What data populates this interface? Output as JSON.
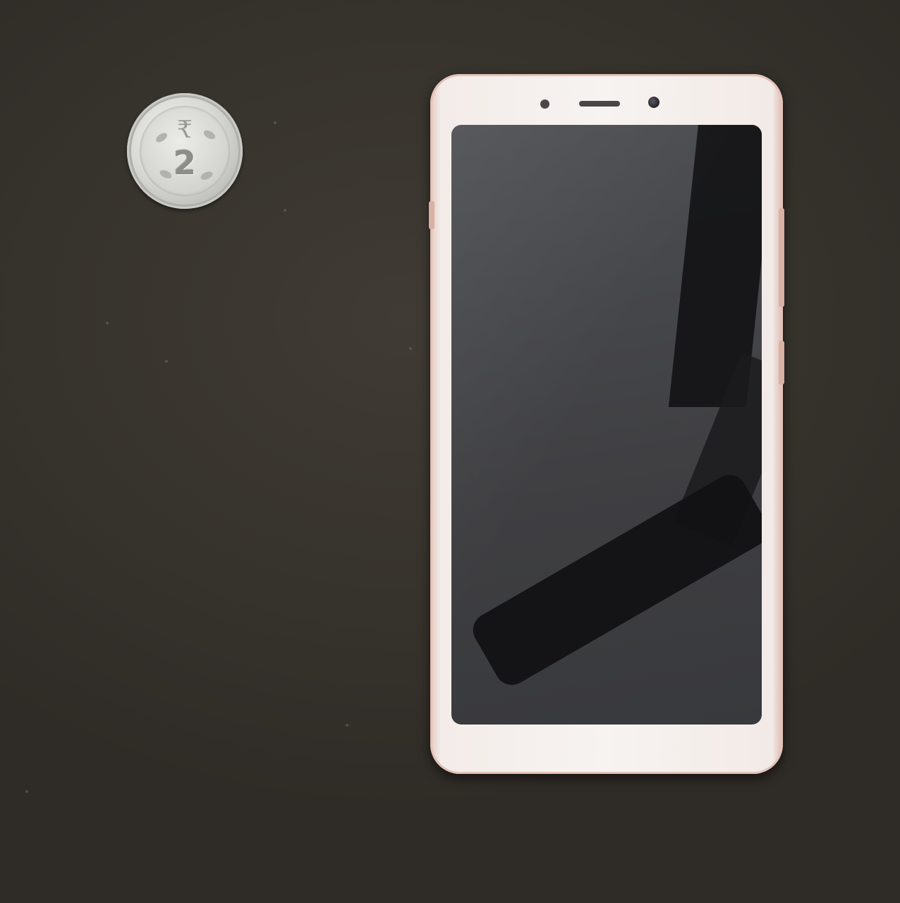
{
  "scene": {
    "surface_color": "#3a3630",
    "objects": [
      "coin",
      "smartphone"
    ]
  },
  "coin": {
    "symbol": "₹",
    "denomination": "2",
    "color": "#d9d9d6"
  },
  "phone": {
    "body_color": "#f7f3f1",
    "frame_accent_color": "#ddb9ad",
    "screen_color": "#46474a",
    "screen_state": "off"
  }
}
